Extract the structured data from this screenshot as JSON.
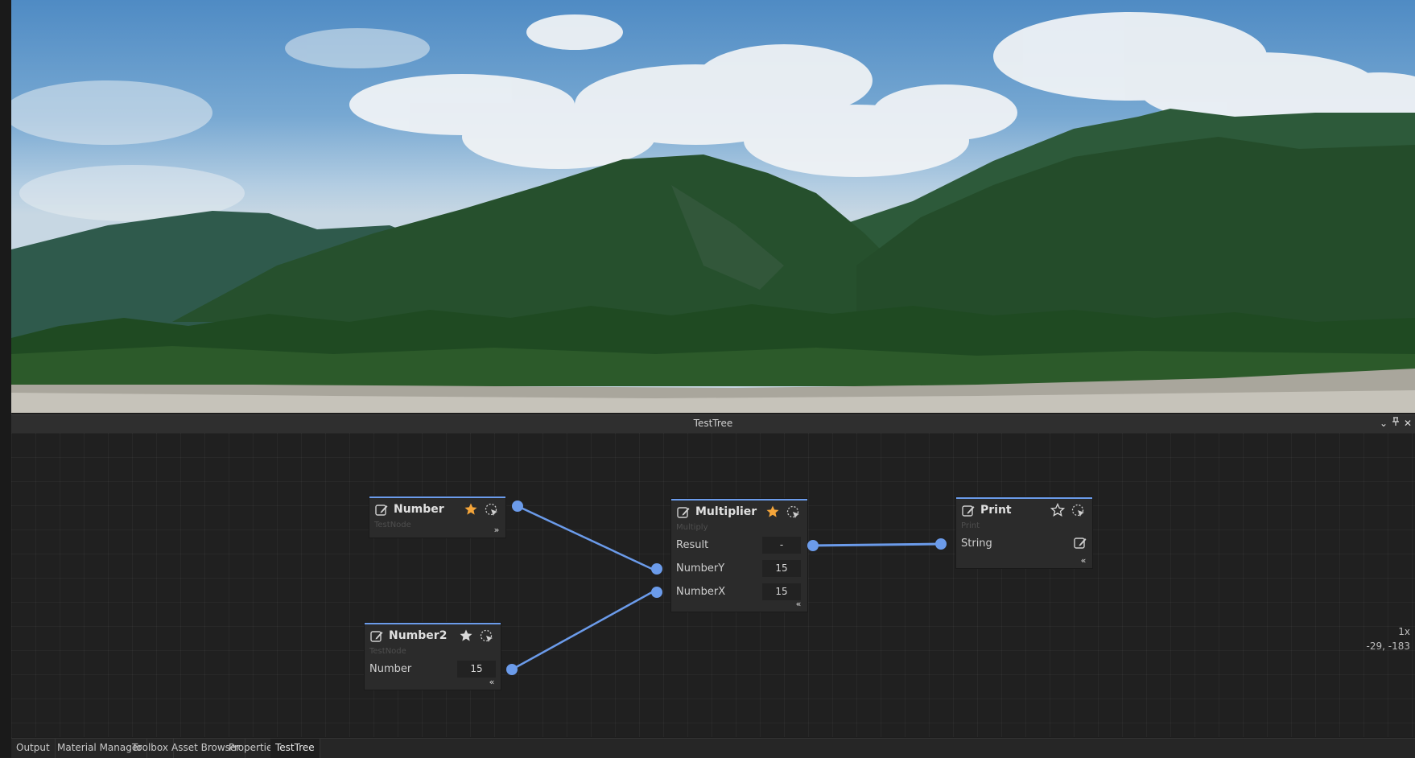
{
  "panel": {
    "title": "TestTree"
  },
  "nodes": {
    "number": {
      "title": "Number",
      "subtitle": "TestNode"
    },
    "number2": {
      "title": "Number2",
      "subtitle": "TestNode",
      "rows": [
        {
          "label": "Number",
          "value": "15"
        }
      ]
    },
    "multiplier": {
      "title": "Multiplier",
      "subtitle": "Multiply",
      "rows": [
        {
          "label": "Result",
          "value": "-"
        },
        {
          "label": "NumberY",
          "value": "15"
        },
        {
          "label": "NumberX",
          "value": "15"
        }
      ]
    },
    "print": {
      "title": "Print",
      "subtitle": "Print",
      "rows": [
        {
          "label": "String"
        }
      ]
    }
  },
  "graph_status": {
    "zoom": "1x",
    "offset": "-29, -183"
  },
  "tabs": [
    "Output",
    "Material Manager",
    "Toolbox",
    "Asset Browser",
    "Properties",
    "TestTree"
  ],
  "active_tab": "TestTree",
  "colors": {
    "accent": "#6b9bea",
    "star_active": "#f4a53a",
    "graph_bg": "#202020",
    "node_bg": "#2b2b2b"
  },
  "icons": {
    "header": [
      "chevron-down-icon",
      "pin-icon",
      "close-icon"
    ],
    "node": [
      "edit-icon",
      "star-icon",
      "cursor-select-icon"
    ],
    "footer": [
      "collapse-up-icon",
      "expand-down-icon"
    ]
  }
}
